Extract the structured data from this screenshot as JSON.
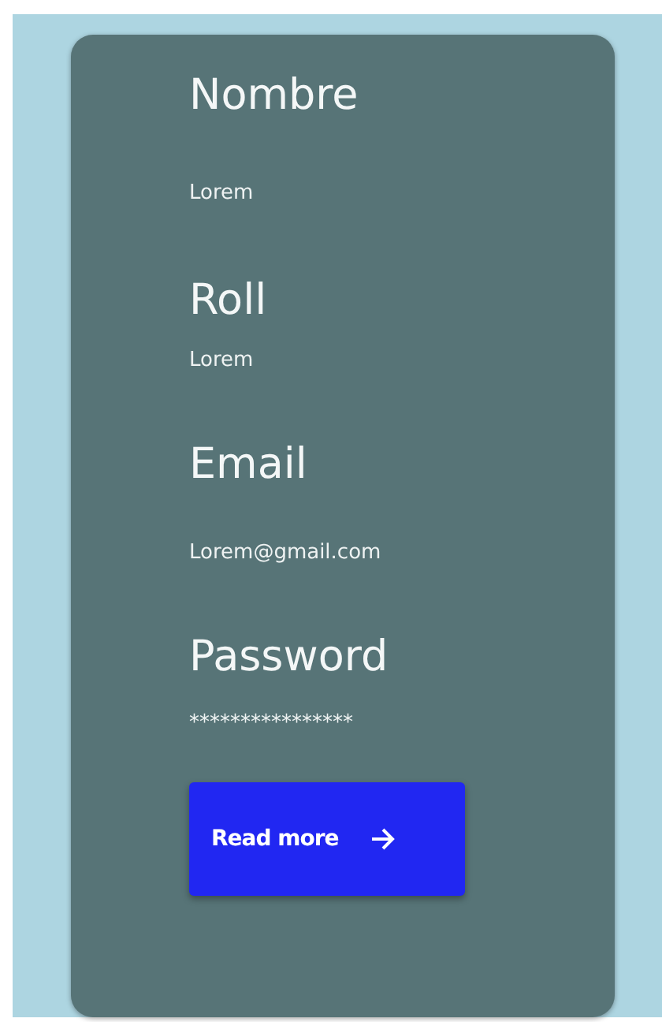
{
  "fields": [
    {
      "label": "Nombre",
      "value": "Lorem"
    },
    {
      "label": "Roll",
      "value": "Lorem"
    },
    {
      "label": "Email",
      "value": "Lorem@gmail.com"
    },
    {
      "label": "Password",
      "value": "****************"
    }
  ],
  "button": {
    "label": "Read more"
  }
}
